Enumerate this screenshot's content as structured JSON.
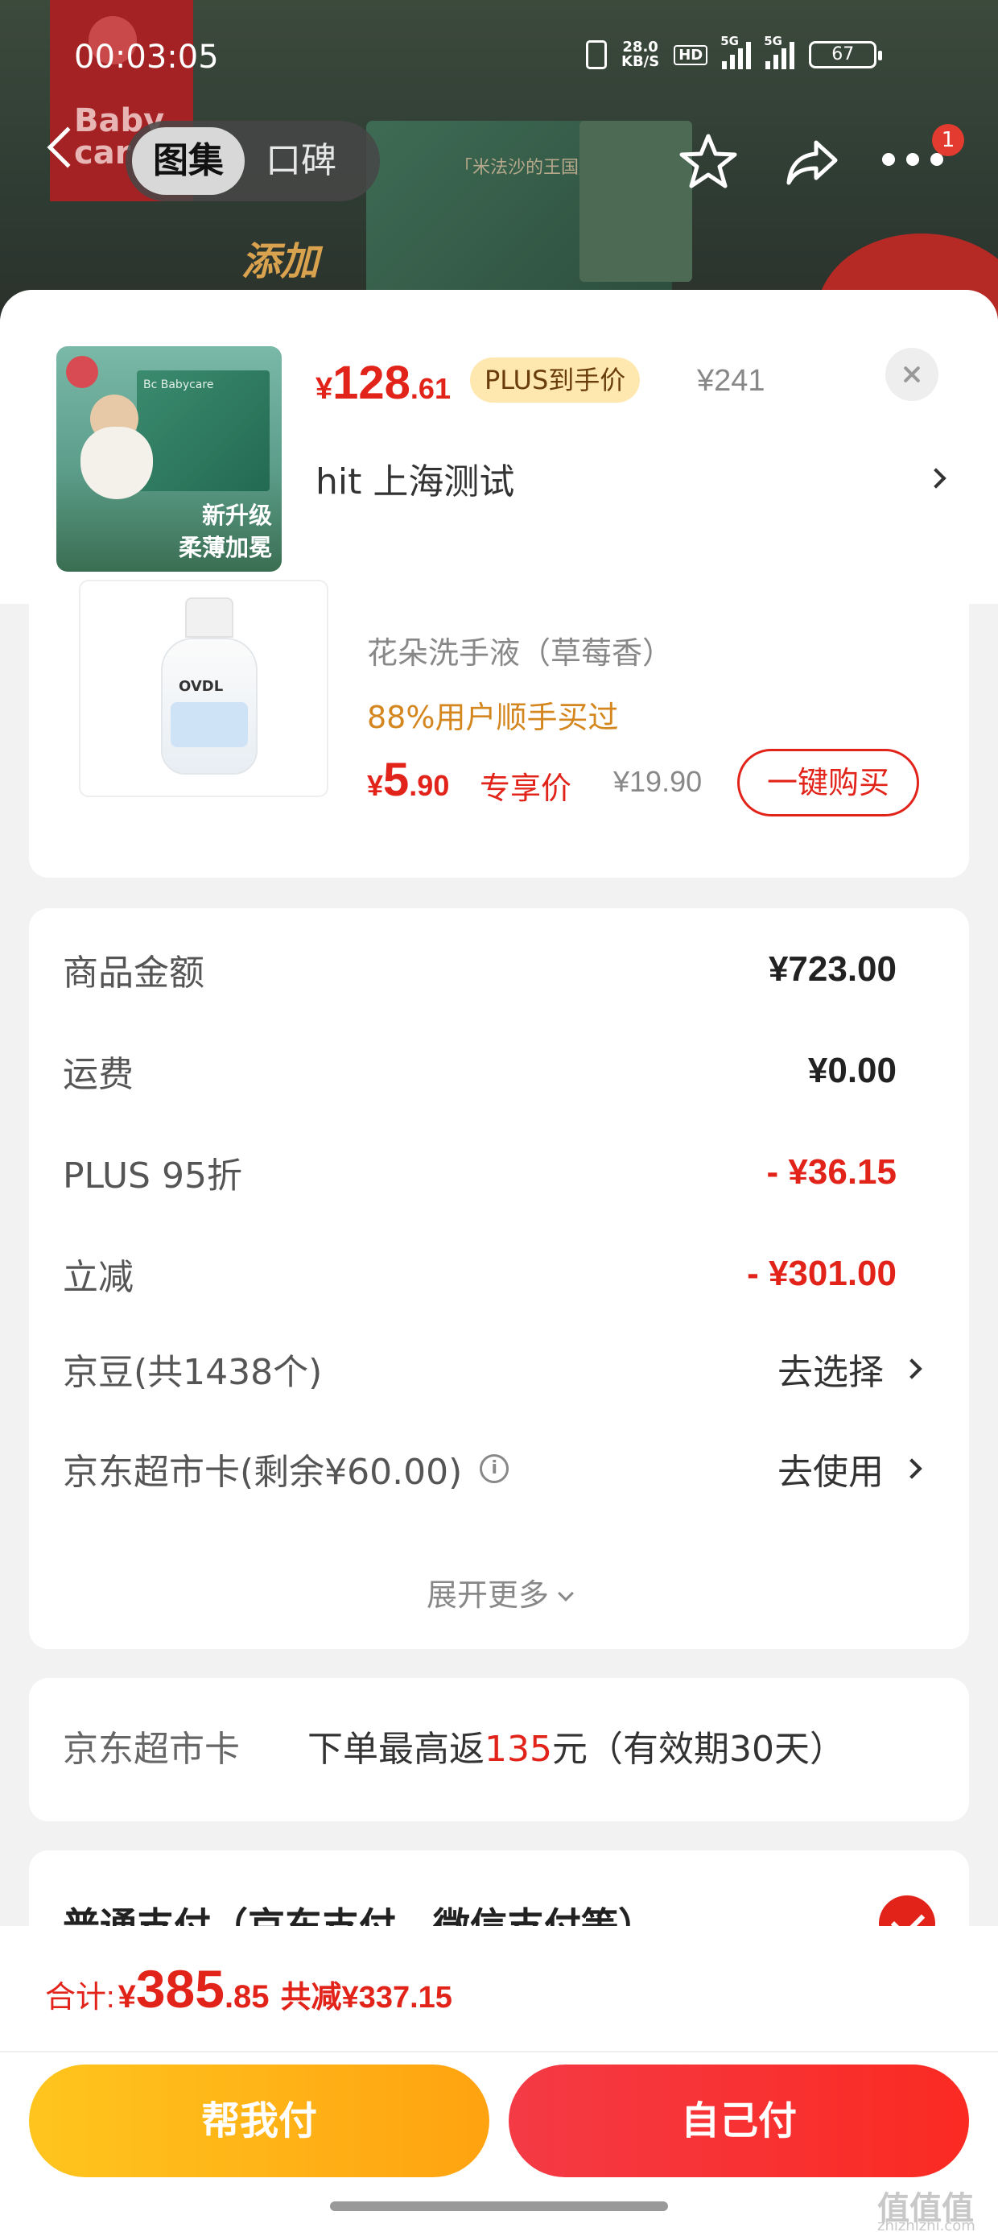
{
  "status_bar": {
    "time": "00:03:05",
    "net_speed": "28.0",
    "net_unit": "KB/S",
    "hd": "HD",
    "sig1": "5G",
    "sig2": "5G",
    "battery": "67"
  },
  "nav": {
    "tabs": [
      {
        "label": "图集",
        "active": true
      },
      {
        "label": "口碑",
        "active": false
      }
    ],
    "badge": "1"
  },
  "background": {
    "brand": "Baby care",
    "promo": "添加",
    "box_text": "「米法沙的王国」"
  },
  "header": {
    "thumb_caption": [
      "新升级",
      "柔薄加冕"
    ],
    "price_currency": "¥",
    "price_int": "128",
    "price_dec": ".61",
    "plus_tag": "PLUS到手价",
    "original_price": "¥241",
    "address": "hit  上海测试"
  },
  "upsell": {
    "brand": "OVDL",
    "title": "花朵洗手液（草莓香）",
    "sold_text": "88%用户顺手买过",
    "price_currency": "¥",
    "price_int": "5",
    "price_dec": ".90",
    "price_label": "专享价",
    "original_price": "¥19.90",
    "buy_button": "一键购买"
  },
  "breakdown": {
    "rows": [
      {
        "label": "商品金额",
        "value": "¥723.00"
      },
      {
        "label": "运费",
        "value": "¥0.00"
      },
      {
        "label": "PLUS 95折",
        "value": "- ¥36.15"
      },
      {
        "label": "立减",
        "value": "- ¥301.00"
      }
    ],
    "jingdou_label": "京豆(共1438个)",
    "jingdou_action": "去选择",
    "card_label": "京东超市卡(剩余¥60.00)",
    "card_action": "去使用",
    "expand": "展开更多"
  },
  "card_promo": {
    "label": "京东超市卡",
    "text_before": "下单最高返",
    "highlight": "135",
    "text_after": "元（有效期30天）"
  },
  "payment": {
    "method": "普通支付（京东支付、微信支付等）"
  },
  "footer": {
    "total_label": "合计:",
    "total_currency": "¥",
    "total_int": "385",
    "total_dec": ".85",
    "total_saved": "共减¥337.15",
    "help_pay": "帮我付",
    "self_pay": "自己付",
    "watermark": "值值值",
    "watermark_sub": "zhizhizhi.com"
  },
  "colors": {
    "accent_red": "#e2231a",
    "help_button": "#ffb416",
    "plus_tag_bg": "#ffe8b0"
  }
}
